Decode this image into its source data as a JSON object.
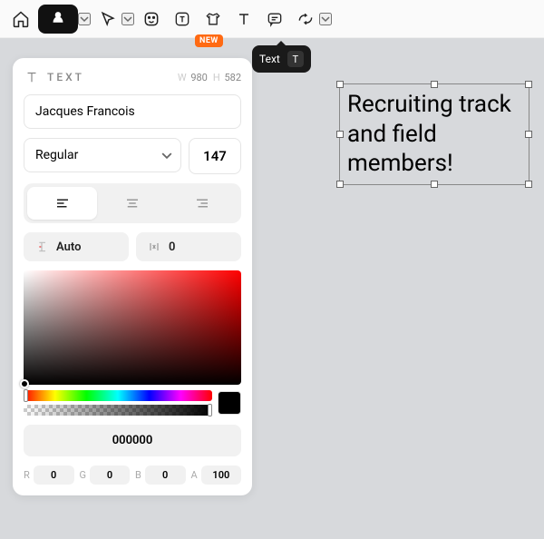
{
  "toolbar": {
    "new_badge": "NEW",
    "tooltip_label": "Text",
    "tooltip_key": "T"
  },
  "panel": {
    "title": "TEXT",
    "width_label": "W",
    "width_value": "980",
    "height_label": "H",
    "height_value": "582",
    "font_family": "Jacques Francois",
    "font_weight": "Regular",
    "font_size": "147",
    "line_height_label": "Auto",
    "letter_spacing": "0",
    "hex": "000000",
    "r_label": "R",
    "r_value": "0",
    "g_label": "G",
    "g_value": "0",
    "b_label": "B",
    "b_value": "0",
    "a_label": "A",
    "a_value": "100"
  },
  "canvas": {
    "text": "Recruiting track and field members!"
  }
}
